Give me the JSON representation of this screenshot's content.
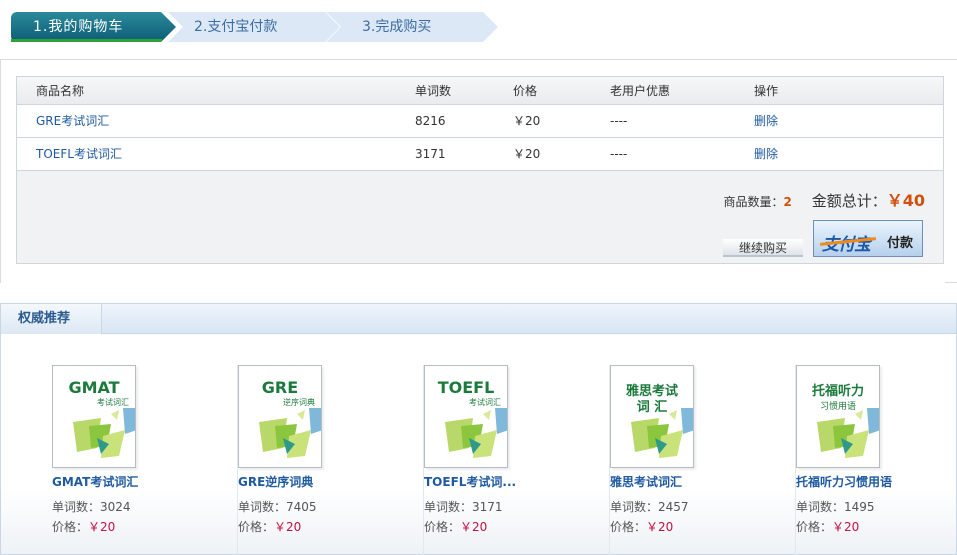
{
  "steps": [
    {
      "label": "1.我的购物车"
    },
    {
      "label": "2.支付宝付款"
    },
    {
      "label": "3.完成购买"
    }
  ],
  "cart": {
    "headers": [
      "商品名称",
      "单词数",
      "价格",
      "老用户优惠",
      "操作"
    ],
    "rows": [
      {
        "name": "GRE考试词汇",
        "words": "8216",
        "price": "￥20",
        "discount": "----",
        "action": "删除"
      },
      {
        "name": "TOEFL考试词汇",
        "words": "3171",
        "price": "￥20",
        "discount": "----",
        "action": "删除"
      }
    ],
    "qty_label": "商品数量：",
    "qty_value": "2",
    "total_label": "金额总计：",
    "total_value": "￥40",
    "continue_label": "继续购买",
    "alipay_logo": "支付宝",
    "alipay_pay": "付款"
  },
  "recommend": {
    "title": "权威推荐",
    "words_label": "单词数：",
    "price_label": "价格：",
    "books": [
      {
        "cover_title": "GMAT",
        "cover_sub": "考试词汇",
        "name": "GMAT考试词汇",
        "words": "3024",
        "price": "￥20"
      },
      {
        "cover_title": "GRE",
        "cover_sub": "逆序词典",
        "name": "GRE逆序词典",
        "words": "7405",
        "price": "￥20"
      },
      {
        "cover_title": "TOEFL",
        "cover_sub": "考试词汇",
        "name": "TOEFL考试词...",
        "words": "3171",
        "price": "￥20"
      },
      {
        "cover_title": "雅思考试",
        "cover_sub": "词 汇",
        "name": "雅思考试词汇",
        "words": "2457",
        "price": "￥20"
      },
      {
        "cover_title": "托福听力",
        "cover_sub": "习惯用语",
        "name": "托福听力习惯用语",
        "words": "1495",
        "price": "￥20"
      }
    ]
  },
  "colors": {
    "accent_orange": "#d0500b",
    "price_red": "#c0103f",
    "link_blue": "#1f5aa0",
    "cover_green": "#1d7a3d"
  }
}
